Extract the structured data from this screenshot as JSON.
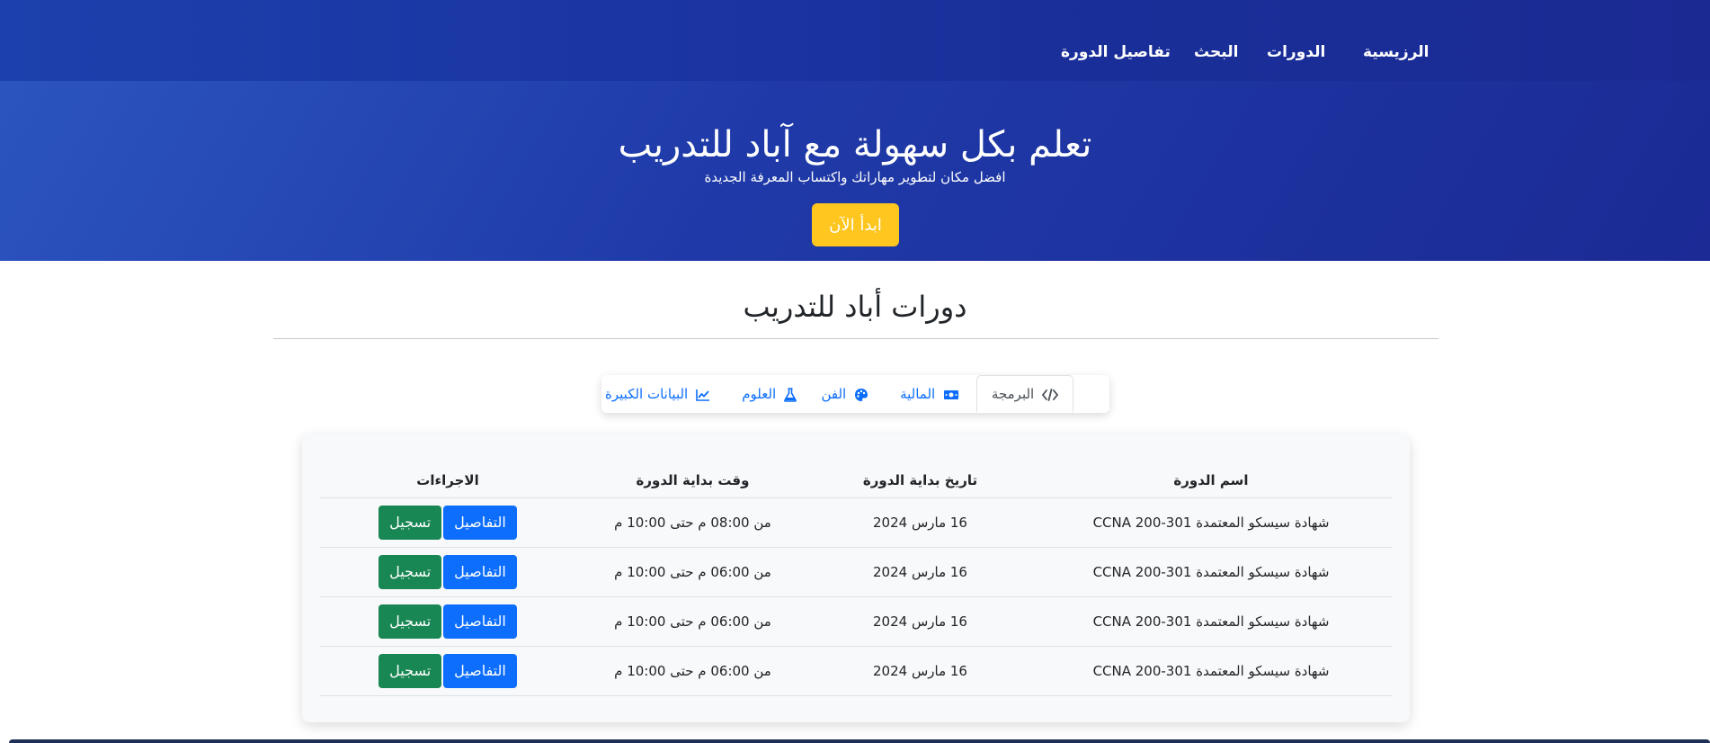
{
  "nav": {
    "home": "الرزيسية",
    "courses": "الدورات",
    "search": "البحث",
    "course_details": "تفاصيل الدورة"
  },
  "hero": {
    "title": "تعلم بكل سهولة مع آباد للتدريب",
    "subtitle": "افضل مكان لتطوير مهاراتك واكتساب المعرفة الجديدة",
    "cta_label": "ابدأ الآن"
  },
  "section": {
    "title": "دورات أباد للتدريب"
  },
  "tabs": [
    {
      "label": "البرمجة",
      "icon": "code-icon",
      "active": true
    },
    {
      "label": "المالية",
      "icon": "money-icon",
      "active": false
    },
    {
      "label": "الفن",
      "icon": "palette-icon",
      "active": false
    },
    {
      "label": "العلوم",
      "icon": "flask-icon",
      "active": false
    },
    {
      "label": "البيانات الكبيرة",
      "icon": "chart-line-icon",
      "active": false
    }
  ],
  "table": {
    "headers": {
      "name": "اسم الدورة",
      "date": "تاريخ بداية الدورة",
      "time": "وقت بداية الدورة",
      "actions": "الاجراءات"
    },
    "rows": [
      {
        "name": "شهادة سيسكو المعتمدة CCNA 200-301",
        "date": "16 مارس 2024",
        "time": "من 08:00 م حتى 10:00 م",
        "details": "التفاصيل",
        "register": "تسجيل"
      },
      {
        "name": "شهادة سيسكو المعتمدة CCNA 200-301",
        "date": "16 مارس 2024",
        "time": "من 06:00 م حتى 10:00 م",
        "details": "التفاصيل",
        "register": "تسجيل"
      },
      {
        "name": "شهادة سيسكو المعتمدة CCNA 200-301",
        "date": "16 مارس 2024",
        "time": "من 06:00 م حتى 10:00 م",
        "details": "التفاصيل",
        "register": "تسجيل"
      },
      {
        "name": "شهادة سيسكو المعتمدة CCNA 200-301",
        "date": "16 مارس 2024",
        "time": "من 06:00 م حتى 10:00 م",
        "details": "التفاصيل",
        "register": "تسجيل"
      }
    ]
  },
  "colors": {
    "header_blue": "#1f3aa8",
    "cta_yellow": "#ffc61f",
    "link_blue": "#0d6efd",
    "register_green": "#198754"
  }
}
